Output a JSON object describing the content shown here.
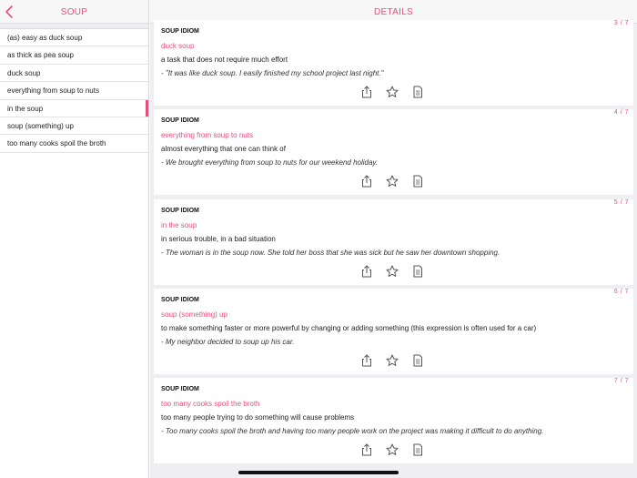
{
  "sidebar": {
    "title": "SOUP",
    "items": [
      {
        "label": "(as) easy as duck soup"
      },
      {
        "label": "as thick as pea soup"
      },
      {
        "label": "duck soup"
      },
      {
        "label": "everything from soup to nuts"
      },
      {
        "label": "in the soup",
        "selected": true
      },
      {
        "label": "soup (something) up"
      },
      {
        "label": "too many cooks spoil the broth"
      }
    ]
  },
  "detail": {
    "title": "DETAILS",
    "cards": [
      {
        "count": "3 / 7",
        "label": "SOUP IDIOM",
        "idiom": "duck soup",
        "meaning": "a task that does not require much effort",
        "example": "- \"It was like duck soup. I easily finished my school project last night.\""
      },
      {
        "count": "4 / 7",
        "label": "SOUP IDIOM",
        "idiom": "everything from soup to nuts",
        "meaning": "almost everything that one can think of",
        "example": "- We brought everything from soup to nuts for our weekend holiday."
      },
      {
        "count": "5 / 7",
        "label": "SOUP IDIOM",
        "idiom": "in the soup",
        "meaning": "in serious trouble, in a bad situation",
        "example": "- The woman is in the soup now. She told her boss that she was sick but he saw her downtown shopping."
      },
      {
        "count": "6 / 7",
        "label": "SOUP IDIOM",
        "idiom": "soup (something) up",
        "meaning": "to make something faster or more powerful by changing or adding something (this expression is often used for a car)",
        "example": "- My neighbor decided to soup up his car."
      },
      {
        "count": "7 / 7",
        "label": "SOUP IDIOM",
        "idiom": "too many cooks spoil the broth",
        "meaning": "too many people trying to do something will cause problems",
        "example": "- Too many cooks spoil the broth and having too many people work on the project was making it difficult to do anything."
      }
    ]
  },
  "colors": {
    "accent": "#e6507a",
    "background": "#efeff3",
    "card": "#ffffff"
  },
  "icons": [
    "back-chevron-icon",
    "share-icon",
    "star-icon",
    "document-icon"
  ]
}
